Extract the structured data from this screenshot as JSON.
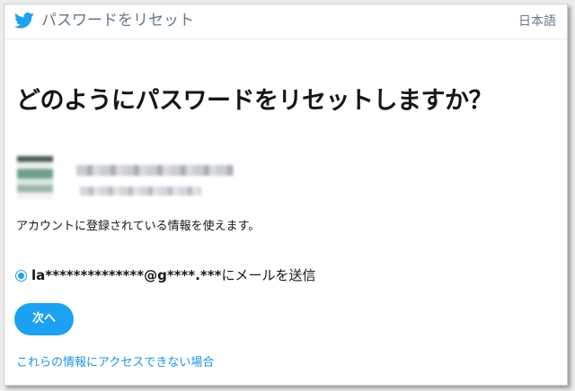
{
  "header": {
    "logo_icon": "twitter-bird-icon",
    "title": "パスワードをリセット",
    "language": "日本語"
  },
  "main": {
    "heading": "どのようにパスワードをリセットしますか？",
    "account": {
      "avatar": "blurred-avatar",
      "name": "blurred",
      "handle": "blurred"
    },
    "info_text": "アカウントに登録されている情報を使えます。",
    "reset_option": {
      "selected": true,
      "masked_email": "la**************@g****.***",
      "suffix": "にメールを送信"
    },
    "next_button": "次へ",
    "help_link": "これらの情報にアクセスできない場合"
  },
  "colors": {
    "accent": "#1da1f2",
    "link": "#1b95e0",
    "text": "#14171a",
    "muted": "#657786"
  }
}
